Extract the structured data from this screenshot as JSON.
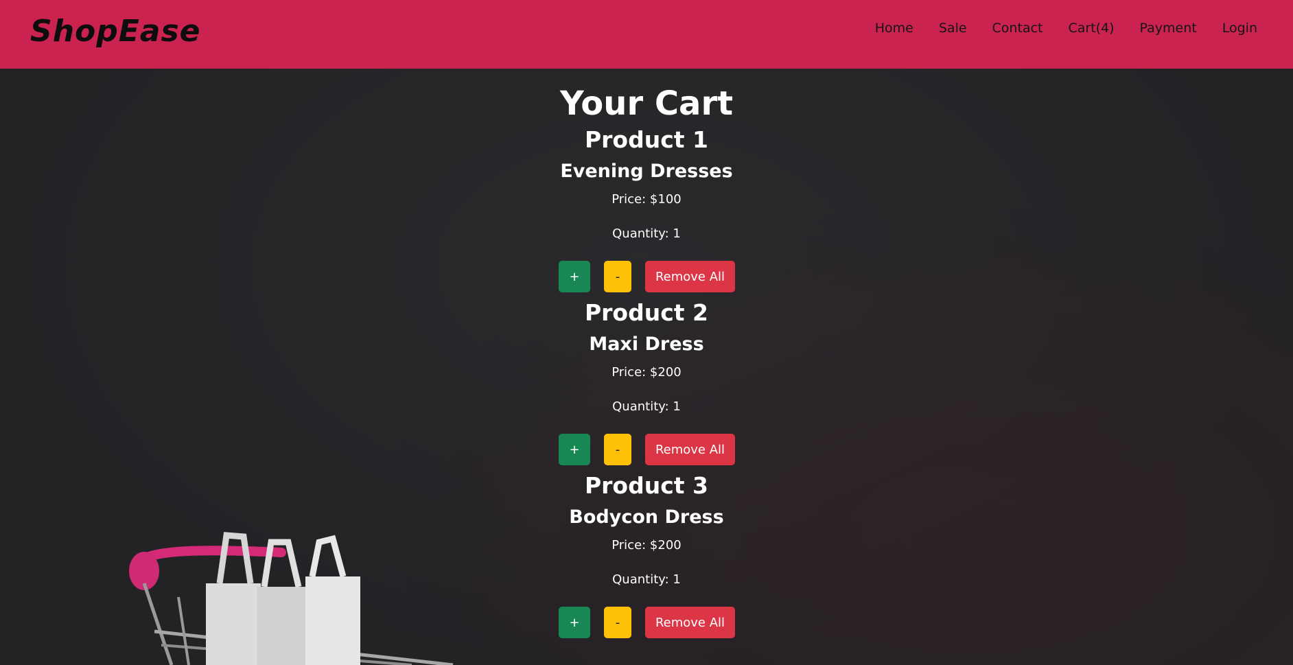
{
  "brand": "ShopEase",
  "nav": [
    {
      "label": "Home"
    },
    {
      "label": "Sale"
    },
    {
      "label": "Contact"
    },
    {
      "label": "Cart(4)"
    },
    {
      "label": "Payment"
    },
    {
      "label": "Login"
    }
  ],
  "cart": {
    "title": "Your Cart",
    "products": [
      {
        "heading": "Product 1",
        "name": "Evening Dresses",
        "price": "Price: $100",
        "quantity": "Quantity: 1",
        "plus_label": "+",
        "minus_label": "-",
        "remove_label": "Remove All"
      },
      {
        "heading": "Product 2",
        "name": "Maxi Dress",
        "price": "Price: $200",
        "quantity": "Quantity: 1",
        "plus_label": "+",
        "minus_label": "-",
        "remove_label": "Remove All"
      },
      {
        "heading": "Product 3",
        "name": "Bodycon Dress",
        "price": "Price: $200",
        "quantity": "Quantity: 1",
        "plus_label": "+",
        "minus_label": "-",
        "remove_label": "Remove All"
      }
    ]
  },
  "colors": {
    "navbar": "#cb2350",
    "plus_button": "#198754",
    "minus_button": "#ffc107",
    "remove_button": "#dc3545",
    "background": "#242326"
  },
  "background_image": {
    "icon": "shopping-cart-with-bags-icon"
  }
}
